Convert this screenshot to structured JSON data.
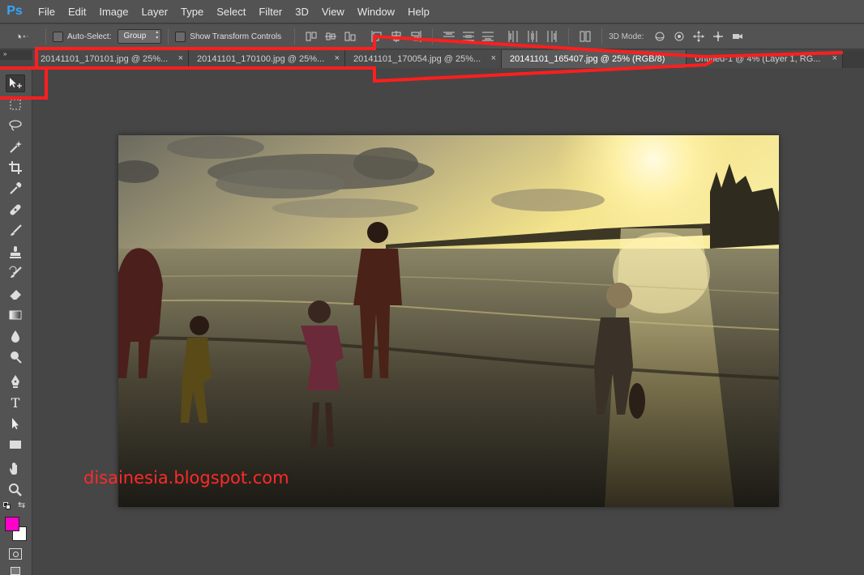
{
  "app": {
    "logo": "Ps"
  },
  "menu": [
    "File",
    "Edit",
    "Image",
    "Layer",
    "Type",
    "Select",
    "Filter",
    "3D",
    "View",
    "Window",
    "Help"
  ],
  "options": {
    "auto_select_label": "Auto-Select:",
    "auto_select_value": "Group",
    "show_transform_label": "Show Transform Controls",
    "mode_3d_label": "3D Mode:"
  },
  "tabs": [
    {
      "label": "20141101_170101.jpg @ 25%...",
      "close": "×"
    },
    {
      "label": "20141101_170100.jpg @ 25%...",
      "close": "×"
    },
    {
      "label": "20141101_170054.jpg @ 25%...",
      "close": "×"
    },
    {
      "label": "20141101_165407.jpg @ 25% (RGB/8)",
      "close": "×"
    },
    {
      "label": "Untitled-1 @ 4% (Layer 1, RG...",
      "close": "×"
    }
  ],
  "collapse_glyph": "»",
  "watermark": "disainesia.blogspot.com",
  "colors": {
    "foreground": "#ff00cc",
    "background": "#ffffff",
    "annotation": "#ff1e1e"
  },
  "tools": [
    "move-icon",
    "marquee-icon",
    "lasso-icon",
    "magic-wand-icon",
    "crop-icon",
    "eyedropper-icon",
    "healing-brush-icon",
    "brush-icon",
    "clone-stamp-icon",
    "history-brush-icon",
    "eraser-icon",
    "gradient-icon",
    "blur-icon",
    "dodge-icon",
    "pen-icon",
    "type-icon",
    "path-selection-icon",
    "rectangle-icon",
    "hand-icon",
    "zoom-icon"
  ],
  "type_tool_glyph": "T"
}
